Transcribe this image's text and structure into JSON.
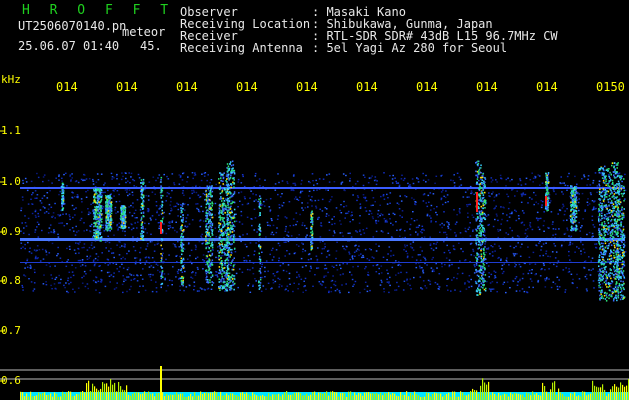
{
  "header": {
    "app_title": "H R O F F T",
    "file_name": "UT2506070140.pn",
    "file_type": "meteor",
    "timestamp": "25.06.07 01:40",
    "value": "45.",
    "fields": [
      {
        "label": "Observer",
        "value": ": Masaki Kano"
      },
      {
        "label": "Receiving Location",
        "value": ": Shibukawa, Gunma, Japan"
      },
      {
        "label": "Receiver",
        "value": ": RTL-SDR SDR# 43dB L15 96.7MHz CW"
      },
      {
        "label": "Receiving Antenna",
        "value": ": 5el Yagi Az 280 for Seoul"
      }
    ]
  },
  "axis": {
    "unit": "kHz",
    "y_labels": [
      "1.1",
      "1.0",
      "0.9",
      "0.8",
      "0.7",
      "0.6"
    ],
    "x_labels": [
      "014",
      "014",
      "014",
      "014",
      "014",
      "014",
      "014",
      "014",
      "014",
      "0150"
    ]
  },
  "colors": {
    "background": "#000000",
    "axis_text": "#ffff00",
    "header_text": "#e8e8e8",
    "title": "#1fd11f",
    "spectrum_low": "#0a1a8a",
    "spectrum_high": "#ff2020",
    "band_line": "#3a5cff",
    "level_fill": "#00e5ff",
    "level_spikes": "#ffff00"
  }
}
